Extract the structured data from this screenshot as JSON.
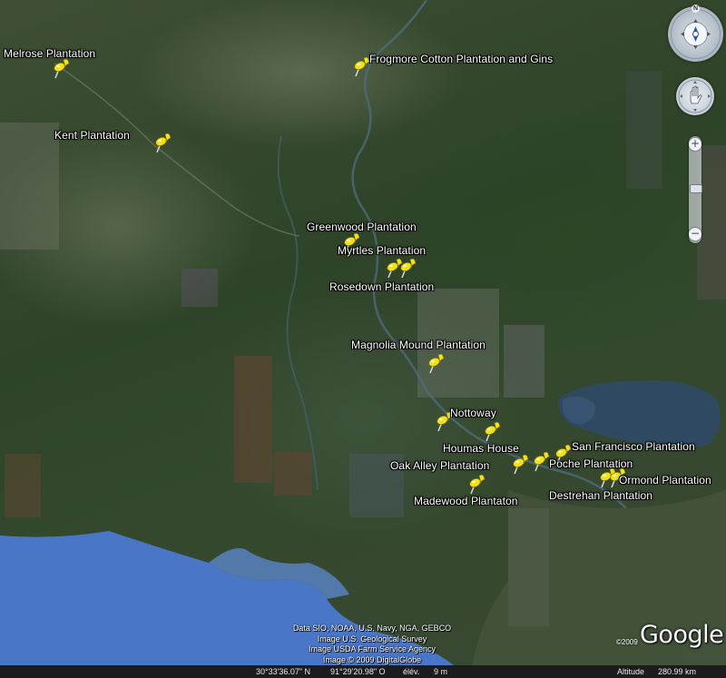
{
  "map": {
    "placemarks": [
      {
        "label": "Melrose Plantation"
      },
      {
        "label": "Frogmore Cotton Plantation and Gins"
      },
      {
        "label": "Kent Plantation"
      },
      {
        "label": "Greenwood Plantation"
      },
      {
        "label": "Myrtles Plantation"
      },
      {
        "label": "Rosedown Plantation"
      },
      {
        "label": "Magnolia Mound Plantation"
      },
      {
        "label": "Nottoway"
      },
      {
        "label": "Houmas House"
      },
      {
        "label": "San Francisco Plantation"
      },
      {
        "label": "Oak Alley Plantation"
      },
      {
        "label": "Poche Plantation"
      },
      {
        "label": "Ormond Plantation"
      },
      {
        "label": "Madewood Plantaton"
      },
      {
        "label": "Destrehan Plantation"
      }
    ],
    "credits": [
      "Data SIO, NOAA, U.S. Navy, NGA, GEBCO",
      "Image U.S. Geological Survey",
      "Image USDA Farm Service Agency",
      "Image © 2009 DigitalGlobe"
    ],
    "logo": "Google",
    "copyright": "©2009"
  },
  "status_bar": {
    "latitude": "30°33'36.07\" N",
    "longitude": "91°29'20.98\" O",
    "elevation_label": "élév.",
    "elevation": "9 m",
    "altitude_label": "Altitude",
    "altitude": "280.99 km"
  },
  "controls": {
    "north_label": "N",
    "zoom_in": "+",
    "zoom_out": "−",
    "zoom_level": 0.45
  },
  "colors": {
    "pin": "#f2e21a",
    "water": "#4a76c8",
    "label_text": "#ffffff"
  }
}
